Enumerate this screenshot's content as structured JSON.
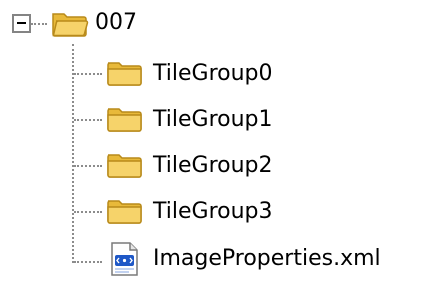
{
  "tree": {
    "root": {
      "label": "007",
      "icon": "folder-open-icon",
      "expanded": true
    },
    "children": [
      {
        "label": "TileGroup0",
        "icon": "folder-icon"
      },
      {
        "label": "TileGroup1",
        "icon": "folder-icon"
      },
      {
        "label": "TileGroup2",
        "icon": "folder-icon"
      },
      {
        "label": "TileGroup3",
        "icon": "folder-icon"
      },
      {
        "label": "ImageProperties.xml",
        "icon": "xml-file-icon"
      }
    ]
  },
  "colors": {
    "folder_fill": "#f6d36a",
    "folder_edge": "#b88a1a",
    "connector": "#8c8c8c"
  }
}
